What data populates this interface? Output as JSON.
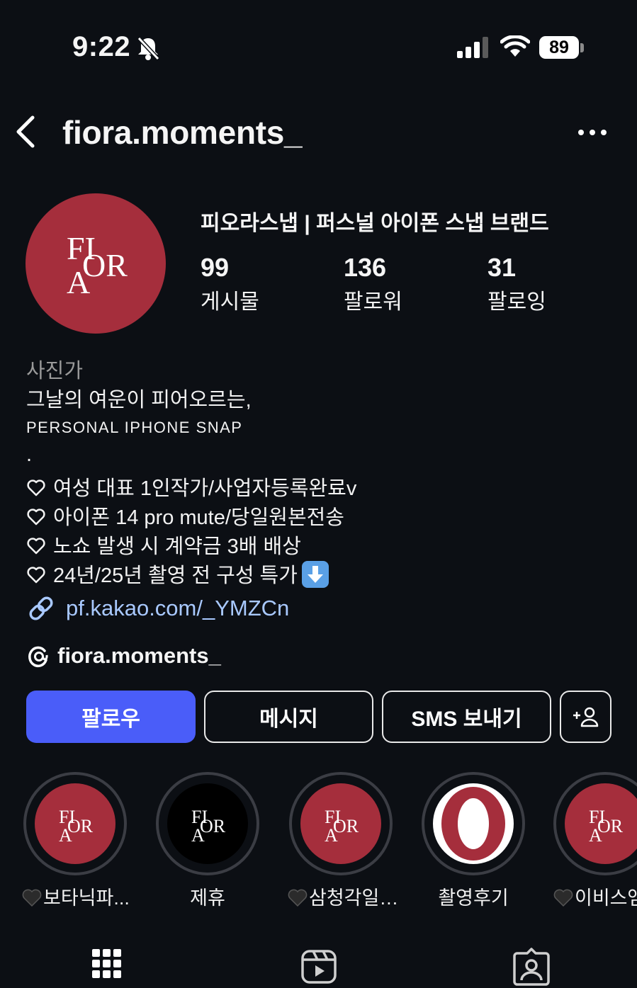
{
  "status_bar": {
    "time": "9:22",
    "battery": "89"
  },
  "header": {
    "username": "fiora.moments_"
  },
  "profile": {
    "avatar_text": "FIORA",
    "display_name": "피오라스냅 | 퍼스널 아이폰 스냅 브랜드",
    "stats": [
      {
        "value": "99",
        "label": "게시물"
      },
      {
        "value": "136",
        "label": "팔로워"
      },
      {
        "value": "31",
        "label": "팔로잉"
      }
    ]
  },
  "bio": {
    "category": "사진가",
    "line1": "그날의 여운이 피어오르는,",
    "line2": "PERSONAL IPHONE SNAP",
    "line3": ".",
    "item1": "여성 대표 1인작가/사업자등록완료v",
    "item2": "아이폰 14 pro mute/당일원본전송",
    "item3": "노쇼 발생 시 계약금 3배 배상",
    "item4": "24년/25년 촬영 전 구성 특가",
    "link": "pf.kakao.com/_YMZCn",
    "threads": "fiora.moments_"
  },
  "buttons": {
    "follow": "팔로우",
    "message": "메시지",
    "sms": "SMS 보내기"
  },
  "highlights": [
    {
      "label": "보타닉파...",
      "style": "logo-red",
      "heart": true
    },
    {
      "label": "제휴",
      "style": "logo-black",
      "heart": false
    },
    {
      "label": "삼청각일…",
      "style": "logo-red",
      "heart": true
    },
    {
      "label": "촬영후기",
      "style": "o-red",
      "heart": false
    },
    {
      "label": "이비스앰",
      "style": "logo-red",
      "heart": true
    }
  ],
  "colors": {
    "background": "#0c0f14",
    "accent_button": "#4a5df9",
    "brand_red": "#a52e3c",
    "link": "#a9c9ff"
  },
  "bottom_tabs": [
    "grid-icon",
    "reels-icon",
    "tagged-icon"
  ]
}
